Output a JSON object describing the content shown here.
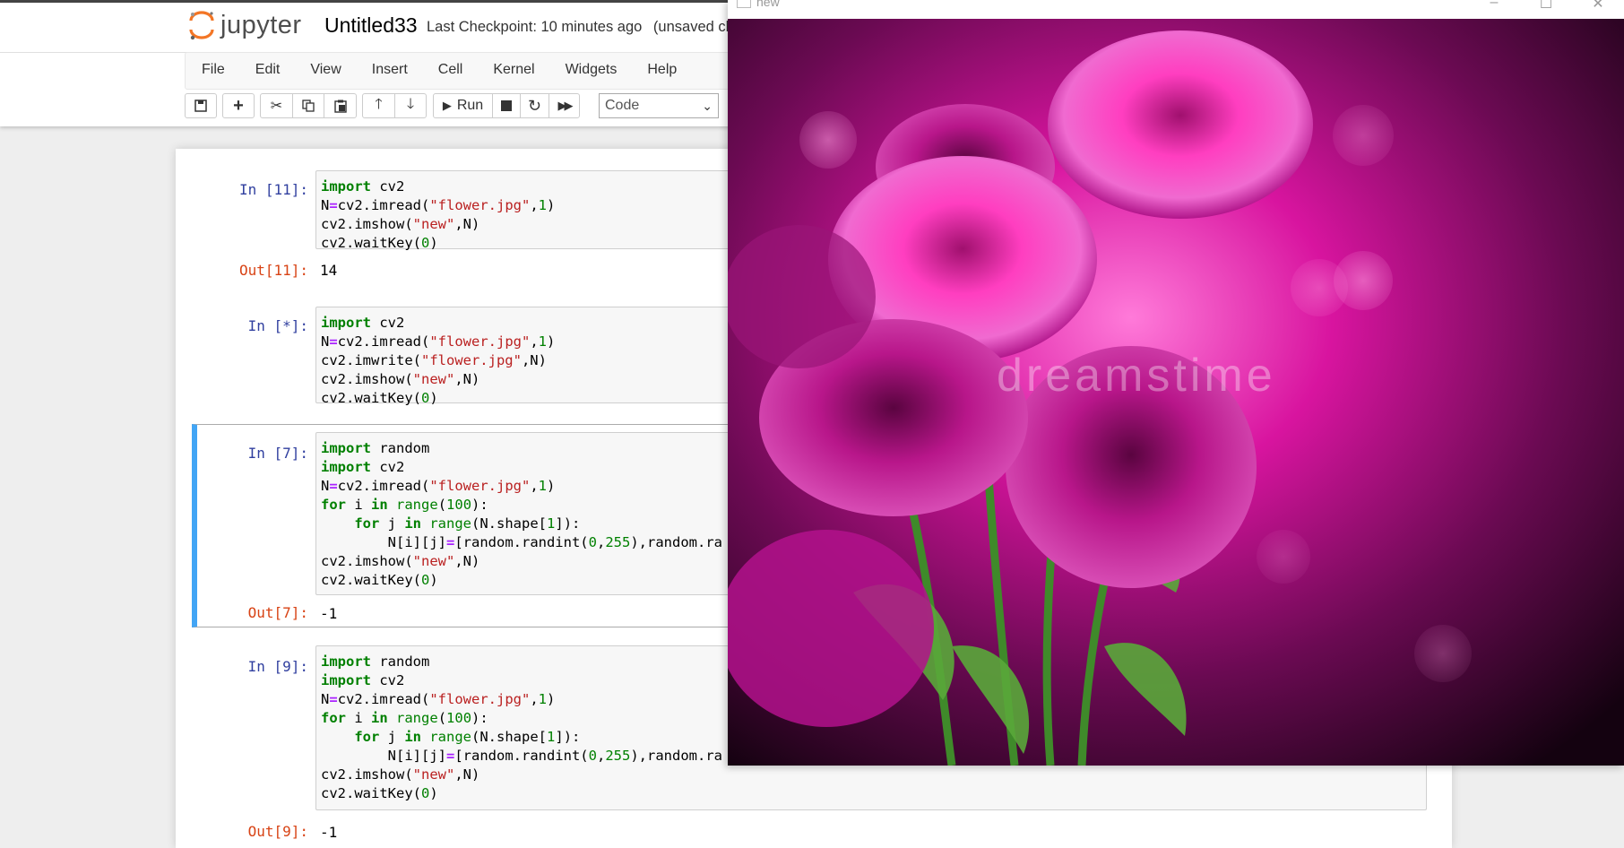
{
  "header": {
    "logo_text": "jupyter",
    "notebook_title": "Untitled33",
    "checkpoint": "Last Checkpoint: 10 minutes ago",
    "unsaved": "(unsaved ch"
  },
  "menu": [
    "File",
    "Edit",
    "View",
    "Insert",
    "Cell",
    "Kernel",
    "Widgets",
    "Help"
  ],
  "toolbar": {
    "run_label": "Run",
    "cell_type": "Code"
  },
  "cells": [
    {
      "in_prompt": "In [11]:",
      "out_prompt": "Out[11]:",
      "output": "14"
    },
    {
      "in_prompt": "In [*]:"
    },
    {
      "in_prompt": "In [7]:",
      "out_prompt": "Out[7]:",
      "output": "-1"
    },
    {
      "in_prompt": "In [9]:",
      "out_prompt": "Out[9]:",
      "output": "-1"
    }
  ],
  "image_window": {
    "title": "new",
    "watermark": "dreamstime"
  },
  "colors": {
    "prompt_in": "#303f9f",
    "prompt_out": "#d84315",
    "selected_border": "#42a5f5",
    "flower": "#e0129a"
  }
}
